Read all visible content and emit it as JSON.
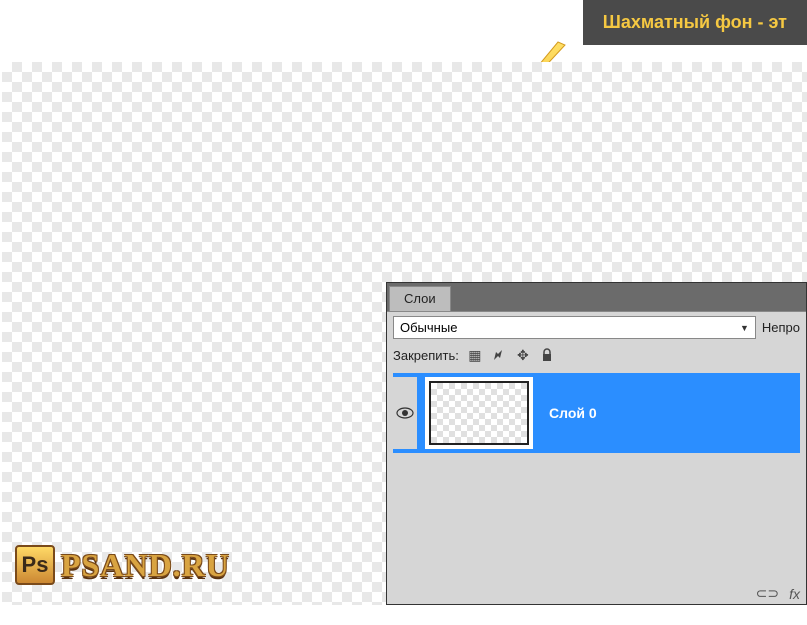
{
  "tooltip": {
    "text": "Шахматный фон - эт"
  },
  "watermark": {
    "icon_text": "Ps",
    "site": "PSAND.RU"
  },
  "layers_panel": {
    "tab": "Слои",
    "blend_mode": "Обычные",
    "opacity_label": "Непро",
    "lock_label": "Закрепить:",
    "layer": {
      "name": "Слой 0"
    },
    "footer_link": "⊂⊃",
    "footer_fx": "fx"
  }
}
